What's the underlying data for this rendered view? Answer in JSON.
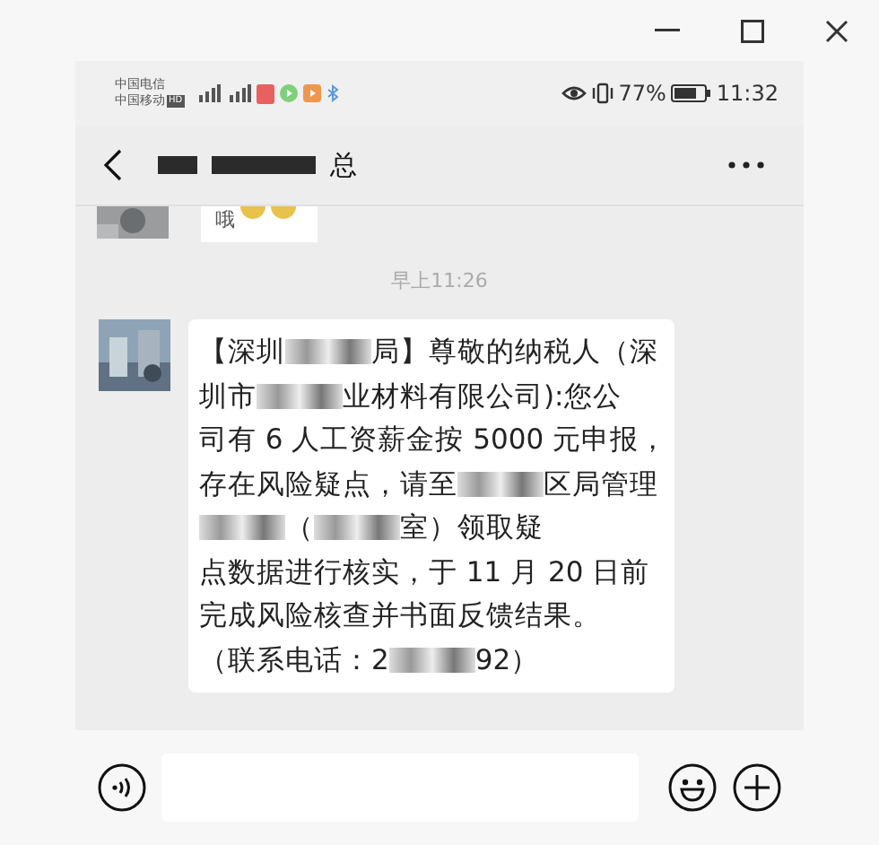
{
  "status_bar": {
    "carriers": [
      "中国电信",
      "中国移动"
    ],
    "hd_badge": "HD",
    "battery_percent": "77%",
    "time": "11:32"
  },
  "chat_header": {
    "title_end": "总"
  },
  "previous_message": {
    "text": "哦"
  },
  "timestamp": "早上11:26",
  "message": {
    "lines": [
      [
        {
          "text": "【深圳"
        },
        {
          "kind": "redacted"
        },
        {
          "text": "局】尊敬的纳税人（深"
        }
      ],
      [
        {
          "text": "圳市"
        },
        {
          "kind": "redacted"
        },
        {
          "text": "业材料有限公司):您公"
        }
      ],
      [
        {
          "text": "司有 6 人工资薪金按 5000 元申报，"
        }
      ],
      [
        {
          "text": "存在风险疑点，请至"
        },
        {
          "kind": "redacted"
        },
        {
          "text": "区局管理"
        }
      ],
      [
        {
          "kind": "redacted"
        },
        {
          "text": "（"
        },
        {
          "kind": "redacted"
        },
        {
          "text": "室）领取疑"
        }
      ],
      [
        {
          "text": "点数据进行核实，于 11 月 20 日前"
        }
      ],
      [
        {
          "text": "完成风险核查并书面反馈结果。"
        }
      ],
      [
        {
          "text": "（联系电话：2"
        },
        {
          "kind": "redacted"
        },
        {
          "text": "92）"
        }
      ]
    ]
  }
}
